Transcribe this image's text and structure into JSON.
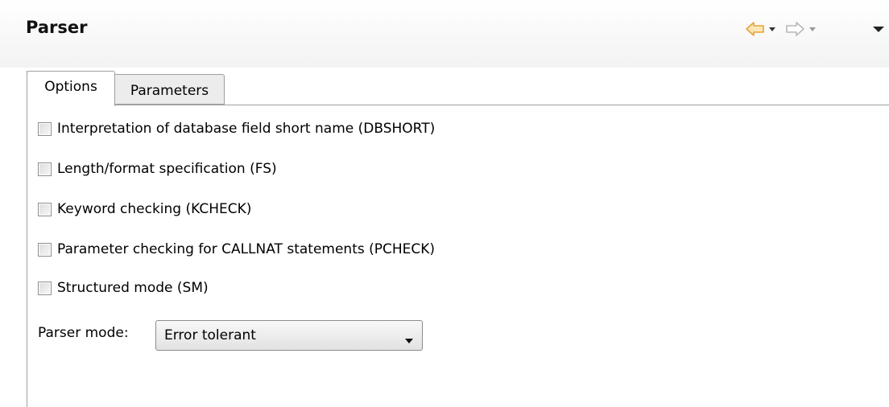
{
  "header": {
    "title": "Parser",
    "nav": {
      "back_icon": "back-arrow-icon",
      "back_menu_icon": "chevron-down-icon",
      "forward_icon": "forward-arrow-icon",
      "forward_menu_icon": "chevron-down-icon",
      "view_menu_icon": "view-menu-icon",
      "back_color": "#e8a23a"
    }
  },
  "tabs": [
    {
      "label": "Options",
      "active": true
    },
    {
      "label": "Parameters",
      "active": false
    }
  ],
  "options": [
    {
      "label": "Interpretation of database field short name (DBSHORT)",
      "checked": false
    },
    {
      "label": "Length/format specification (FS)",
      "checked": false
    },
    {
      "label": "Keyword checking (KCHECK)",
      "checked": false
    },
    {
      "label": "Parameter checking for CALLNAT statements (PCHECK)",
      "checked": false
    },
    {
      "label": "Structured mode (SM)",
      "checked": false
    }
  ],
  "parser_mode": {
    "label": "Parser mode:",
    "value": "Error tolerant"
  }
}
